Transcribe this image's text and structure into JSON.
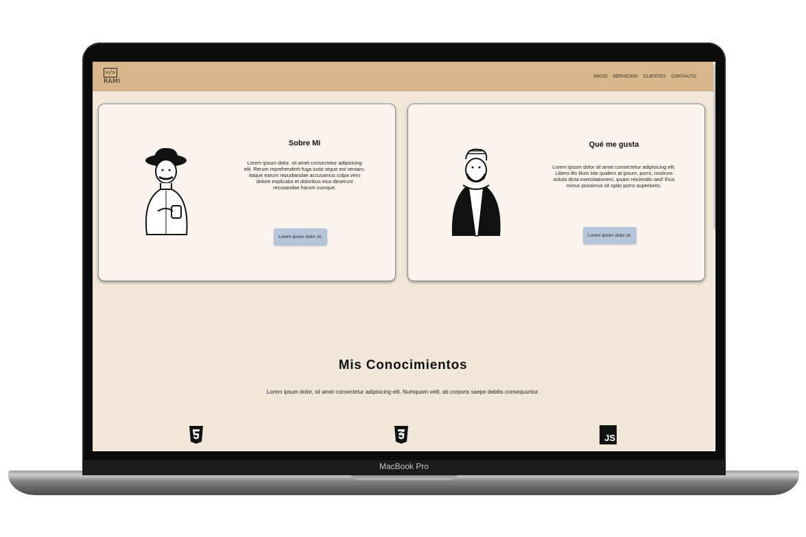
{
  "device": {
    "label": "MacBook Pro"
  },
  "navbar": {
    "logo_symbol": "</>",
    "logo_text": "RAMI",
    "links": [
      "INICIO",
      "SERVICIOS",
      "CLIENTES",
      "CONTACTO"
    ]
  },
  "cards": [
    {
      "title": "Sobre Mi",
      "text": "Lorem ipsum dolor, sit amet consectetur adipisicing elit. Rerum reprehenderit fuga iusto atque est veniam, itaque earum repudiandae accusamus culpa vero dolore explicabo et doloribus eius deserunt recusandae harum cumque.",
      "button": "Lorem ipsum dolor sit."
    },
    {
      "title": "Qué me gusta",
      "text": "Lorem ipsum dolor sit amet consectetur adipisicing elit. Libero illo illum iste quidem at ipsum, porro, nostrum soluta dicta exercitationem, ipsam reiciendis sed! Eius minus possimus sit optio porro asperiores.",
      "button": "Lorem ipsum dolor sit."
    }
  ],
  "knowledge": {
    "title": "Mis Conocimientos",
    "text": "Lorem ipsum dolor, sit amet consectetur adipisicing elit. Numquam velit, ab corporis saepe debitis consequuntur.",
    "icons": [
      "html5-icon",
      "css3-icon",
      "javascript-icon"
    ],
    "js_label": "JS"
  },
  "colors": {
    "navbar": "#d9b68c",
    "page_bg": "#f2e7db",
    "card_bg": "#fbf4ec",
    "button_bg": "#b6c6da"
  }
}
